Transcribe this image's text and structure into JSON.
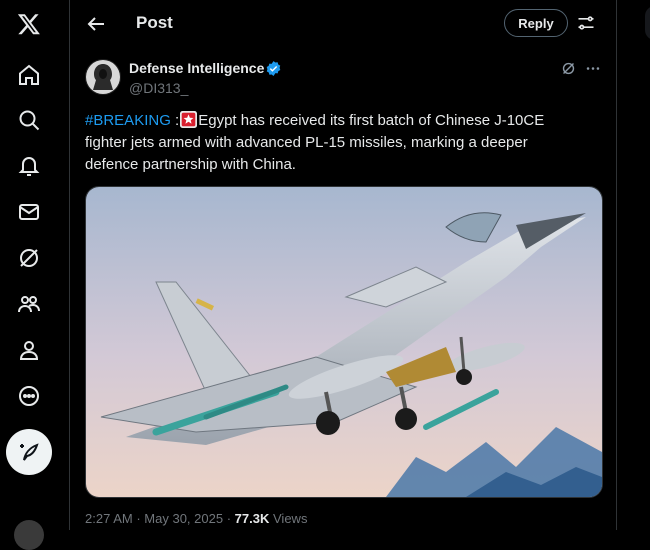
{
  "header": {
    "title": "Post",
    "reply_label": "Reply"
  },
  "sidebar": {
    "items": [
      {
        "icon": "x-logo-icon"
      },
      {
        "icon": "home-icon"
      },
      {
        "icon": "search-icon"
      },
      {
        "icon": "bell-icon"
      },
      {
        "icon": "mail-icon"
      },
      {
        "icon": "grok-icon"
      },
      {
        "icon": "communities-icon"
      },
      {
        "icon": "profile-icon"
      },
      {
        "icon": "more-circle-icon"
      }
    ],
    "compose_icon": "compose-post-icon"
  },
  "post": {
    "author_name": "Defense Intelligence",
    "author_handle": "@DI313_",
    "hashtag": "#BREAKING",
    "colon": " :",
    "text": "Egypt has received its first batch of Chinese J-10CE fighter jets armed with advanced PL-15 missiles, marking a deeper defence partnership with China.",
    "time": "2:27 AM",
    "date": "May 30, 2025",
    "views_count": "77.3K",
    "views_label": "Views",
    "separator": "·"
  },
  "colors": {
    "accent": "#1d9bf0",
    "background": "#000000",
    "text": "#e7e9ea",
    "muted": "#71767b",
    "verified": "#1d9bf0"
  }
}
